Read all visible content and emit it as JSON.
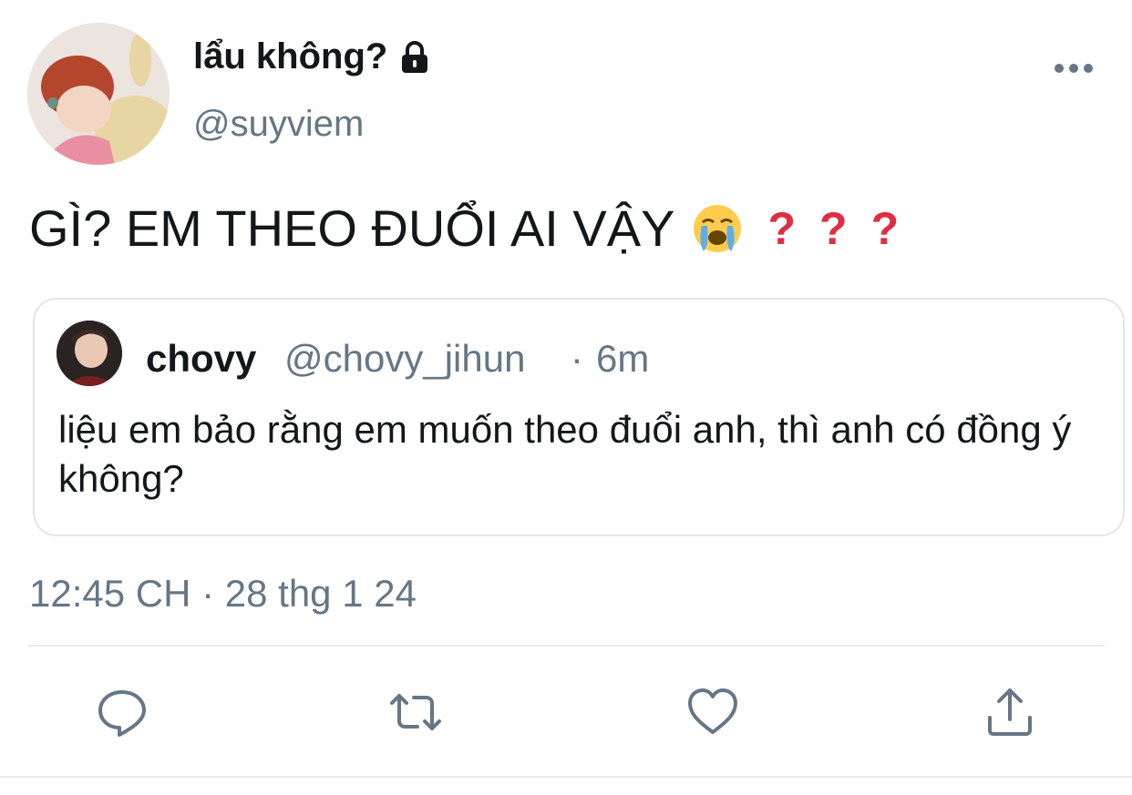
{
  "tweet": {
    "author": {
      "display_name": "lẩu không?",
      "handle": "@suyviem",
      "protected_icon": "lock-icon",
      "avatar_icon": "cartoon-avatar"
    },
    "text": "GÌ? EM THEO ĐUỔI AI VẬY",
    "emojis": [
      "loudly-crying-face",
      "red-question-mark",
      "red-question-mark",
      "red-question-mark"
    ],
    "question_glyph": "?",
    "timestamp": "12:45 CH · 28 thg 1 24"
  },
  "quoted_tweet": {
    "name": "chovy",
    "handle": "@chovy_jihun",
    "separator": "·",
    "time": "6m",
    "text": "liệu em bảo rằng em muốn theo đuổi anh, thì anh có đồng ý không?"
  },
  "actions": [
    "reply-icon",
    "retweet-icon",
    "like-icon",
    "share-icon"
  ],
  "colors": {
    "text": "#14171a",
    "secondary": "#657786",
    "border": "#dfe6ec",
    "question": "#dd2e44"
  }
}
